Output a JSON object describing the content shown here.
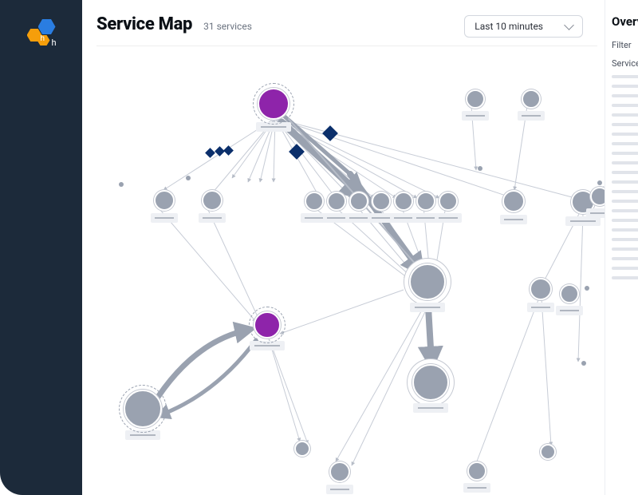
{
  "sidebar": {
    "logo_letter": "h"
  },
  "header": {
    "title": "Service Map",
    "subtitle": "31 services",
    "timerange": {
      "selected": "Last 10 minutes"
    }
  },
  "rightpanel": {
    "title": "Overview",
    "filter_label": "Filter",
    "services_label": "Services",
    "placeholder_row_count": 22
  },
  "graph": {
    "service_count": 31
  }
}
